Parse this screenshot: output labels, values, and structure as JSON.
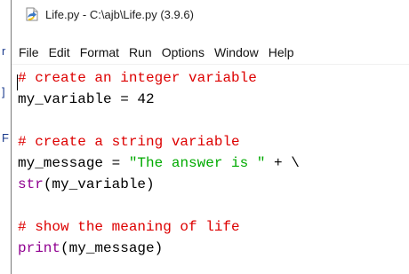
{
  "background_window": {
    "letters": [
      "r",
      "]",
      "F"
    ]
  },
  "window": {
    "title": "Life.py - C:\\ajb\\Life.py (3.9.6)",
    "icon": "python-idle-file-icon"
  },
  "menubar": {
    "items": [
      "File",
      "Edit",
      "Format",
      "Run",
      "Options",
      "Window",
      "Help"
    ]
  },
  "editor": {
    "lines": [
      {
        "tokens": [
          {
            "type": "comment",
            "text": "# create an integer variable"
          }
        ]
      },
      {
        "tokens": [
          {
            "type": "normal",
            "text": "my_variable = 42"
          }
        ]
      },
      {
        "tokens": []
      },
      {
        "tokens": [
          {
            "type": "comment",
            "text": "# create a string variable"
          }
        ]
      },
      {
        "tokens": [
          {
            "type": "normal",
            "text": "my_message = "
          },
          {
            "type": "string",
            "text": "\"The answer is \""
          },
          {
            "type": "normal",
            "text": " + \\"
          }
        ]
      },
      {
        "tokens": [
          {
            "type": "builtin",
            "text": "str"
          },
          {
            "type": "normal",
            "text": "(my_variable)"
          }
        ]
      },
      {
        "tokens": []
      },
      {
        "tokens": [
          {
            "type": "comment",
            "text": "# show the meaning of life"
          }
        ]
      },
      {
        "tokens": [
          {
            "type": "builtin",
            "text": "print"
          },
          {
            "type": "normal",
            "text": "(my_message)"
          }
        ]
      }
    ]
  },
  "colors": {
    "comment": "#dd0000",
    "string": "#00aa00",
    "builtin": "#900090",
    "normal": "#000000"
  }
}
